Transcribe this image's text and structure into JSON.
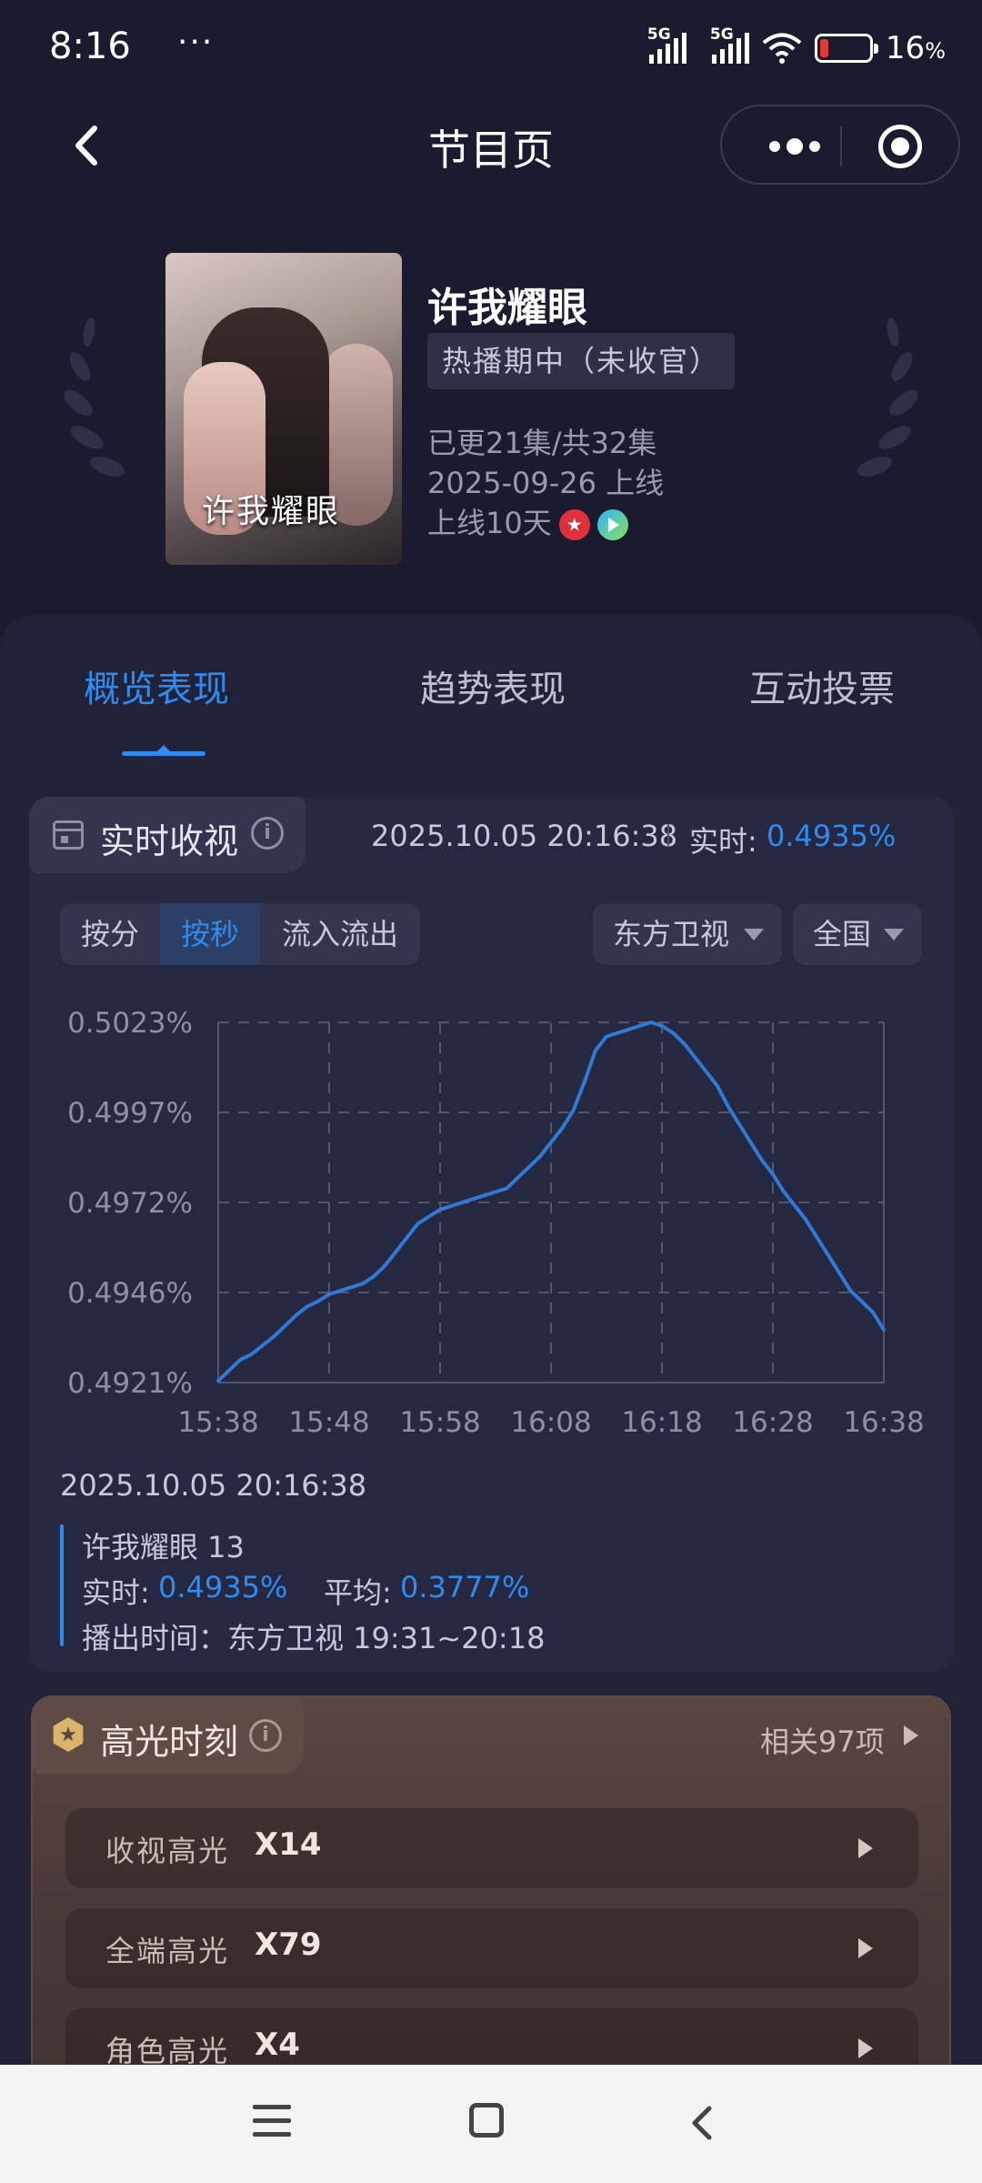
{
  "status_bar": {
    "time": "8:16",
    "dots": "···",
    "network_1": "5G",
    "network_2": "5G",
    "battery_percent": "16",
    "battery_unit": "%"
  },
  "nav": {
    "title": "节目页"
  },
  "show": {
    "title": "许我耀眼",
    "poster_title": "许我耀眼",
    "status": "热播期中（未收官）",
    "episodes": "已更21集/共32集",
    "premiere": "2025-09-26 上线",
    "days_online": "上线10天",
    "platforms": [
      "dragon-tv-logo",
      "tencent-video-logo"
    ]
  },
  "tabs": [
    {
      "label": "概览表现",
      "active": true
    },
    {
      "label": "趋势表现",
      "active": false
    },
    {
      "label": "互动投票",
      "active": false
    }
  ],
  "realtime": {
    "title": "实时收视",
    "timestamp": "2025.10.05 20:16:38",
    "label": "实时:",
    "value": "0.4935%",
    "segments": [
      "按分",
      "按秒",
      "流入流出"
    ],
    "selected_segment": "按秒",
    "channel": "东方卫视",
    "region": "全国"
  },
  "chart_data": {
    "type": "line",
    "title": "",
    "xlabel": "",
    "ylabel": "",
    "x_ticks": [
      "15:38",
      "15:48",
      "15:58",
      "16:08",
      "16:18",
      "16:28",
      "16:38"
    ],
    "y_ticks": [
      "0.4921%",
      "0.4946%",
      "0.4972%",
      "0.4997%",
      "0.5023%"
    ],
    "ylim": [
      0.4921,
      0.5023
    ],
    "xlim_minutes": [
      0,
      60
    ],
    "grid": true,
    "line_color": "#2e7ad6",
    "series": [
      {
        "x": [
          0,
          1,
          2,
          3,
          4,
          5,
          6,
          7,
          8,
          9,
          10,
          11,
          12,
          13,
          14,
          15,
          16,
          17,
          18,
          19,
          20,
          21,
          22,
          23,
          24,
          25,
          26,
          27,
          28,
          29,
          30,
          31,
          32,
          33,
          34,
          35,
          36,
          37,
          38,
          39,
          40,
          41,
          42,
          43,
          44,
          45,
          46,
          47,
          48,
          49,
          50,
          51,
          52,
          53,
          54,
          55,
          56,
          57,
          58,
          59,
          60
        ],
        "y": [
          0.49215,
          0.49245,
          0.49275,
          0.4929,
          0.49315,
          0.4934,
          0.4937,
          0.494,
          0.49425,
          0.4944,
          0.4946,
          0.4947,
          0.4948,
          0.4949,
          0.4951,
          0.4954,
          0.4958,
          0.4962,
          0.4966,
          0.4968,
          0.497,
          0.4971,
          0.4972,
          0.4973,
          0.4974,
          0.4975,
          0.4976,
          0.4979,
          0.4982,
          0.4985,
          0.4989,
          0.4993,
          0.4998,
          0.5006,
          0.5015,
          0.5019,
          0.502,
          0.5021,
          0.5022,
          0.5023,
          0.5022,
          0.502,
          0.5017,
          0.5013,
          0.5009,
          0.5005,
          0.4999,
          0.4994,
          0.4989,
          0.4984,
          0.498,
          0.4975,
          0.4971,
          0.4967,
          0.4962,
          0.4957,
          0.4952,
          0.4947,
          0.4944,
          0.4941,
          0.4936
        ]
      }
    ]
  },
  "detail": {
    "timestamp": "2025.10.05 20:16:38",
    "episode": "许我耀眼 13",
    "realtime_label": "实时:",
    "realtime_value": "0.4935%",
    "avg_label": "平均:",
    "avg_value": "0.3777%",
    "airtime": "播出时间：东方卫视 19:31~20:18"
  },
  "highlights": {
    "title": "高光时刻",
    "more": "相关97项",
    "items": [
      {
        "label": "收视高光",
        "value": "X14"
      },
      {
        "label": "全端高光",
        "value": "X79"
      },
      {
        "label": "角色高光",
        "value": "X4"
      }
    ]
  }
}
